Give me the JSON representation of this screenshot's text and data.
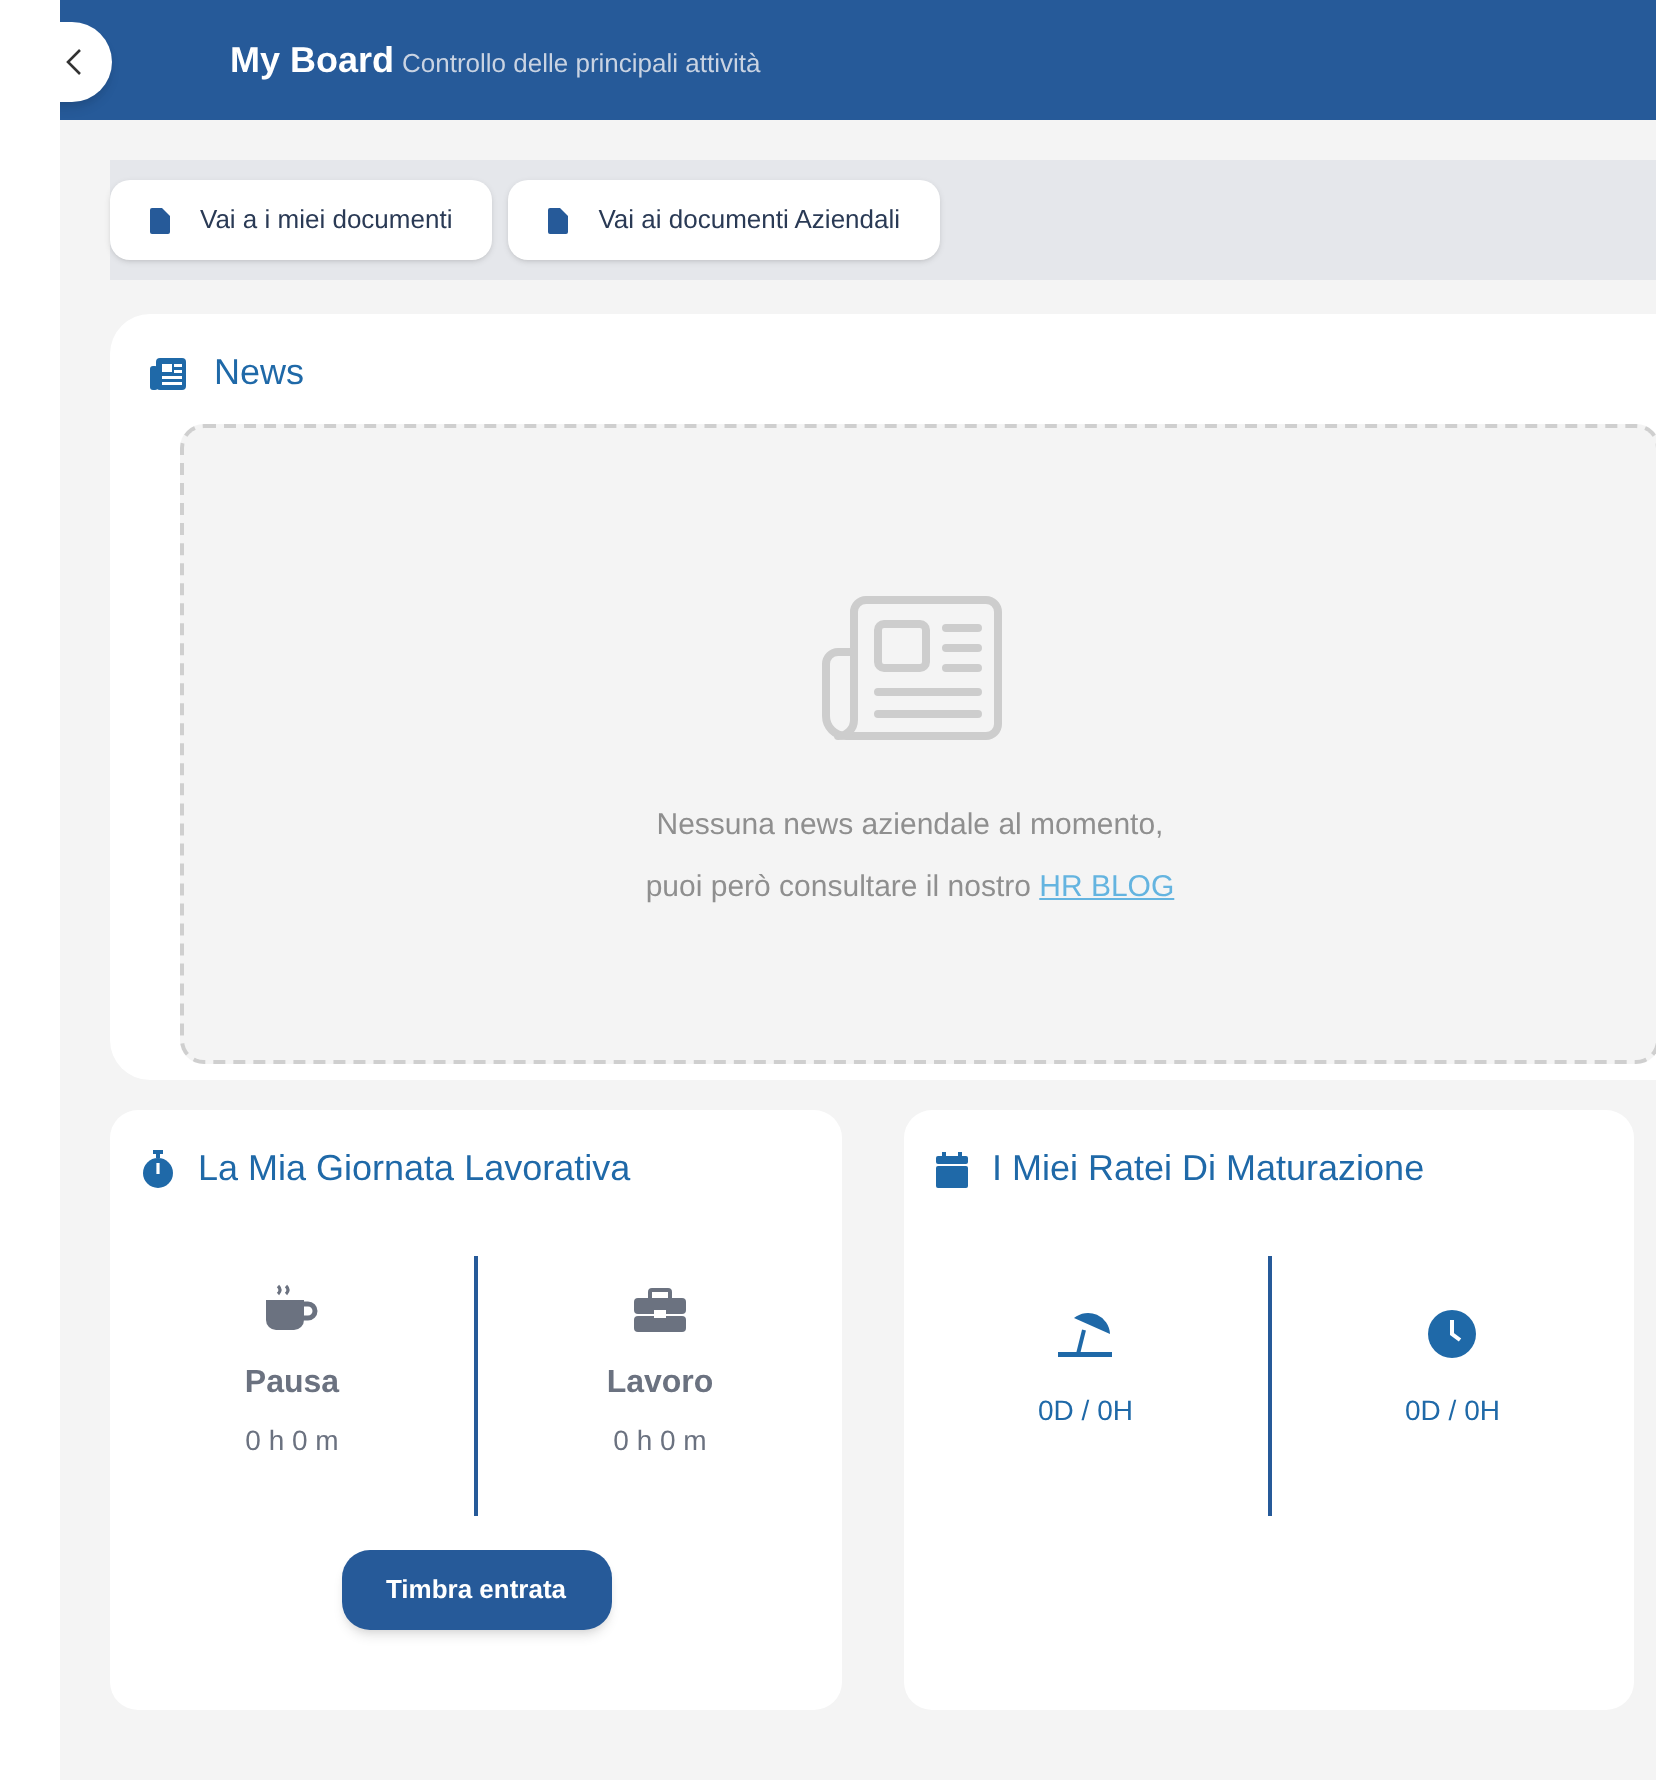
{
  "header": {
    "title": "My Board",
    "subtitle": "Controllo delle principali attività"
  },
  "shortcuts": [
    {
      "label": "Vai a i miei documenti"
    },
    {
      "label": "Vai ai documenti Aziendali"
    }
  ],
  "news": {
    "title": "News",
    "empty_line_1": "Nessuna news aziendale al momento,",
    "empty_line_2": "puoi però consultare il nostro ",
    "link": "HR BLOG"
  },
  "workday": {
    "title": "La Mia Giornata Lavorativa",
    "items": [
      {
        "kind": "pause",
        "label": "Pausa",
        "value": "0 h 0 m"
      },
      {
        "kind": "work",
        "label": "Lavoro",
        "value": "0 h 0 m"
      }
    ],
    "button": "Timbra entrata"
  },
  "accruals": {
    "title": "I Miei Ratei Di Maturazione",
    "items": [
      {
        "kind": "vacation",
        "value": "0D / 0H"
      },
      {
        "kind": "permit",
        "value": "0D / 0H"
      }
    ]
  }
}
